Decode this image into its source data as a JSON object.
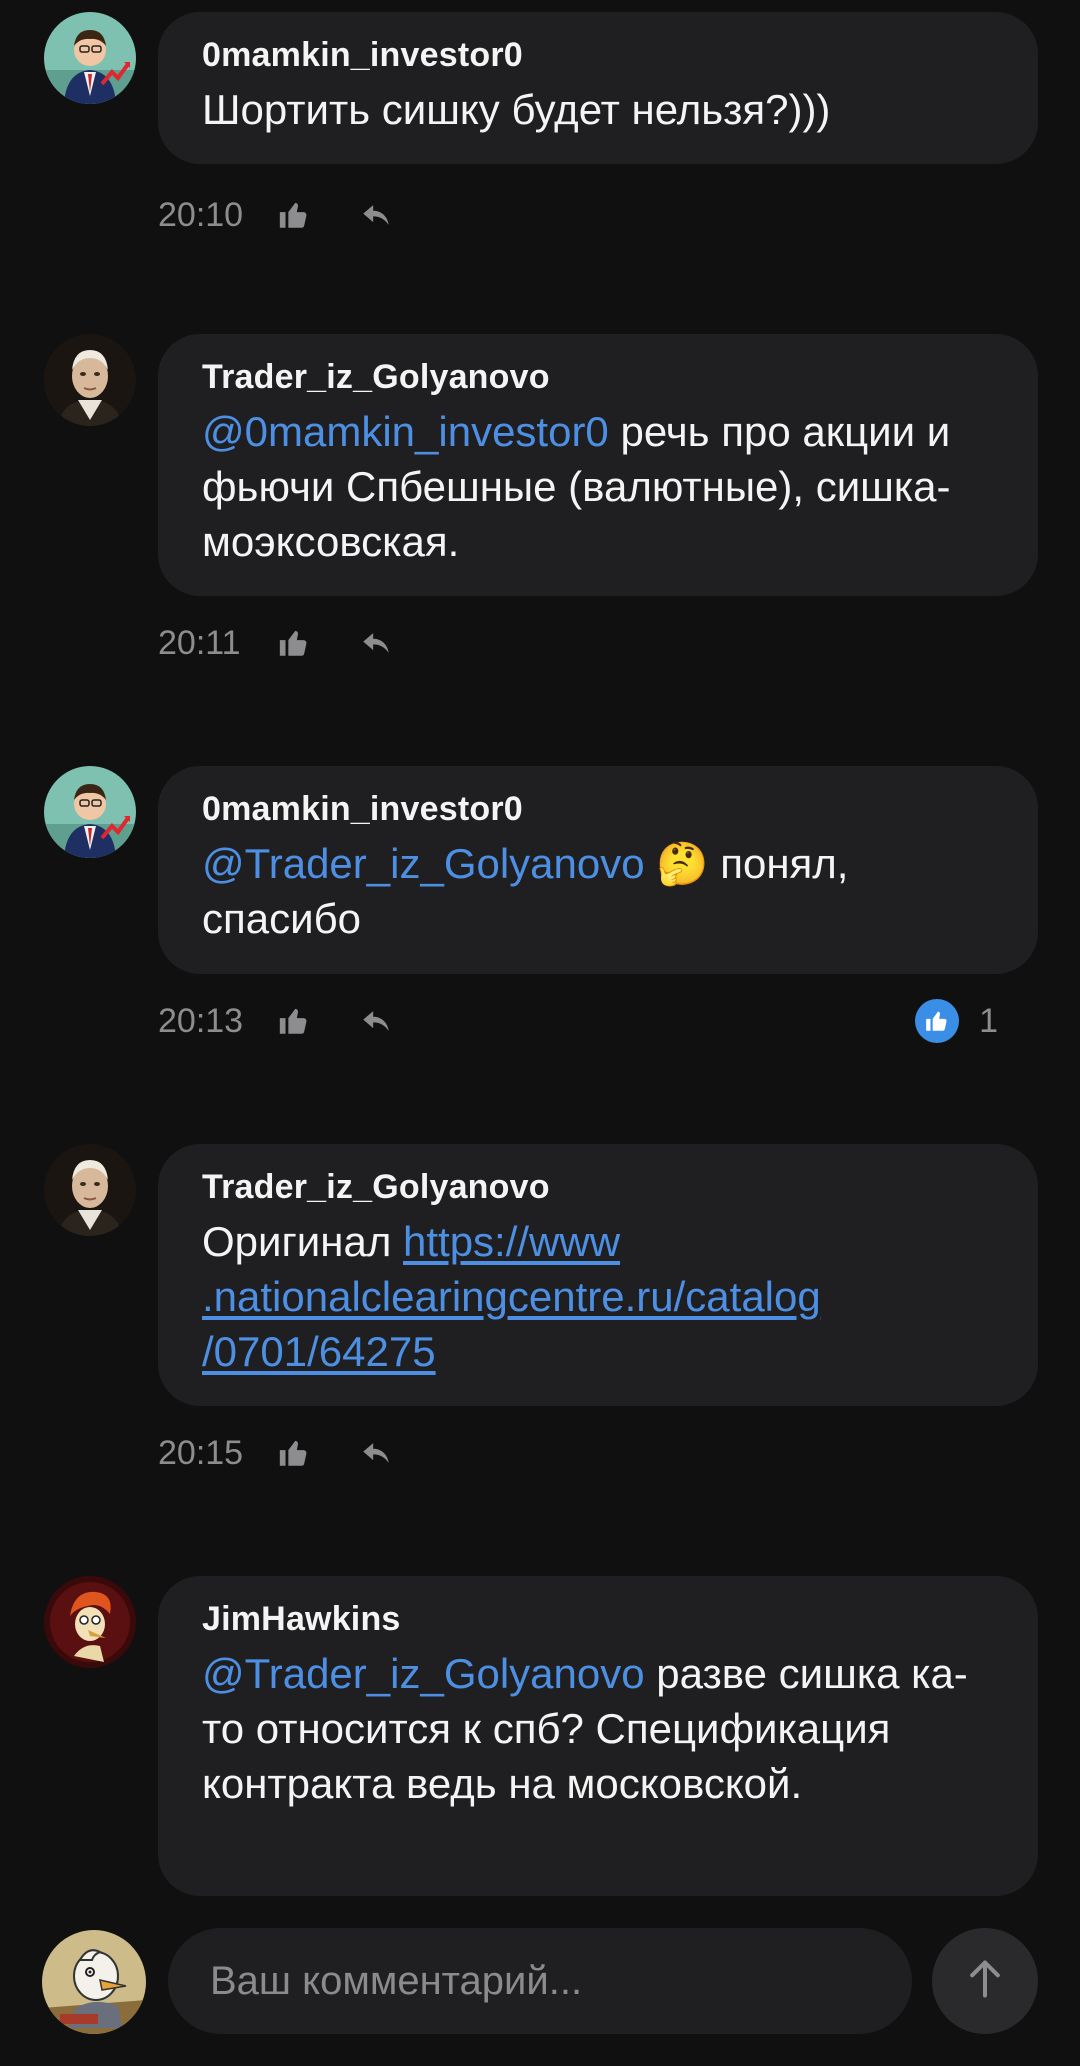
{
  "colors": {
    "background": "#101010",
    "bubble": "#1f1f21",
    "mention": "#4d8fe3",
    "meta_text": "#8d8d8f",
    "like_badge": "#3a8ee6"
  },
  "comments": [
    {
      "author": "0mamkin_investor0",
      "avatar_icon": "investor-avatar",
      "text_plain": "Шортить сишку будет нельзя?)))",
      "time": "20:10"
    },
    {
      "author": "Trader_iz_Golyanovo",
      "avatar_icon": "portrait-avatar",
      "mention": "@0mamkin_investor0",
      "text_after": " речь про акции и фьючи Спбешные (валютные), сишка- моэксовская.",
      "time": "20:11"
    },
    {
      "author": "0mamkin_investor0",
      "avatar_icon": "investor-avatar",
      "mention": "@Trader_iz_Golyanovo",
      "emoji": "🤔",
      "text_after": " понял, спасибо",
      "time": "20:13",
      "likes": "1"
    },
    {
      "author": "Trader_iz_Golyanovo",
      "avatar_icon": "portrait-avatar",
      "text_before": "Оригинал ",
      "link_line1": "https://www",
      "link_line2": ".nationalclearingcentre.ru/catalog",
      "link_line3": "/0701/64275",
      "time": "20:15"
    },
    {
      "author": "JimHawkins",
      "avatar_icon": "cartoon-avatar",
      "mention": "@Trader_iz_Golyanovo",
      "text_after": " разве сишка ка-то относится к спб? Спецификация контракта ведь на московской."
    }
  ],
  "composer": {
    "placeholder": "Ваш комментарий...",
    "avatar_icon": "user-duck-avatar",
    "send_icon": "arrow-up-icon"
  }
}
